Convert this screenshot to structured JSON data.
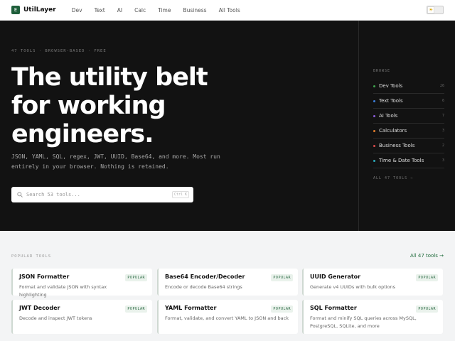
{
  "header": {
    "logo_mark": "E",
    "brand": "UtilLayer",
    "nav": [
      "Dev",
      "Text",
      "AI",
      "Calc",
      "Time",
      "Business",
      "All Tools"
    ],
    "theme_icon": "sun-icon"
  },
  "hero": {
    "eyebrow": "47 TOOLS · BROWSER-BASED · FREE",
    "title": "The utility belt for working engineers.",
    "subtitle": "JSON, YAML, SQL, regex, JWT, UUID, Base64, and more. Most run entirely in your browser. Nothing is retained.",
    "search_placeholder": "Search 53 tools...",
    "search_kbd": "Ctrl K"
  },
  "browse": {
    "label": "BROWSE",
    "categories": [
      {
        "name": "Dev Tools",
        "count": "26",
        "color": "#3fa34d"
      },
      {
        "name": "Text Tools",
        "count": "6",
        "color": "#3b7dd8"
      },
      {
        "name": "AI Tools",
        "count": "7",
        "color": "#8a5cd8"
      },
      {
        "name": "Calculators",
        "count": "3",
        "color": "#e07b2a"
      },
      {
        "name": "Business Tools",
        "count": "2",
        "color": "#d84a4a"
      },
      {
        "name": "Time & Date Tools",
        "count": "3",
        "color": "#2aa8b8"
      }
    ],
    "all_link": "ALL 47 TOOLS →"
  },
  "popular": {
    "label": "POPULAR TOOLS",
    "all_link": "All 47 tools →",
    "cards": [
      {
        "title": "JSON Formatter",
        "desc": "Format and validate JSON with syntax highlighting",
        "badge": "POPULAR"
      },
      {
        "title": "Base64 Encoder/Decoder",
        "desc": "Encode or decode Base64 strings",
        "badge": "POPULAR"
      },
      {
        "title": "UUID Generator",
        "desc": "Generate v4 UUIDs with bulk options",
        "badge": "POPULAR"
      },
      {
        "title": "JWT Decoder",
        "desc": "Decode and inspect JWT tokens",
        "badge": "POPULAR"
      },
      {
        "title": "YAML Formatter",
        "desc": "Format, validate, and convert YAML to JSON and back",
        "badge": "POPULAR"
      },
      {
        "title": "SQL Formatter",
        "desc": "Format and minify SQL queries across MySQL, PostgreSQL, SQLite, and more",
        "badge": "POPULAR"
      }
    ]
  }
}
